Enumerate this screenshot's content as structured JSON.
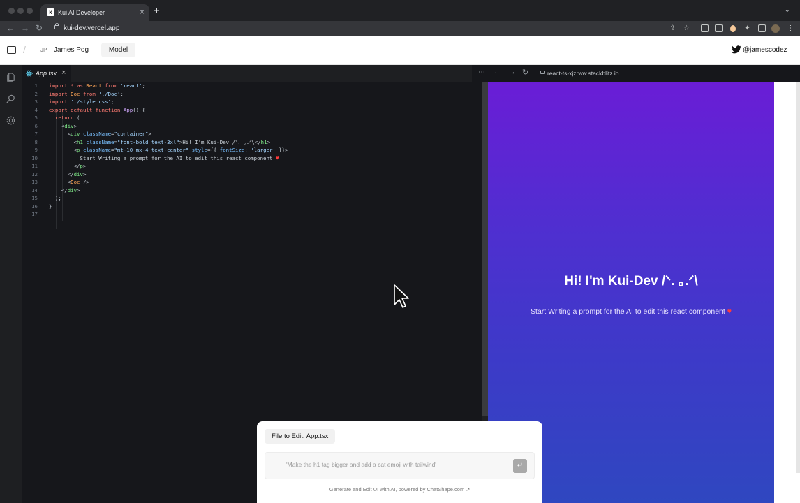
{
  "browser": {
    "tab_title": "Kui AI Developer",
    "tab_favicon": "k",
    "url": "kui-dev.vercel.app"
  },
  "header": {
    "user_initials": "JP",
    "user_name": "James Pog",
    "model_label": "Model",
    "twitter_handle": "@jamescodez"
  },
  "editor": {
    "file_tab": "App.tsx",
    "line_numbers": [
      "1",
      "2",
      "3",
      "4",
      "5",
      "6",
      "7",
      "8",
      "9",
      "10",
      "11",
      "12",
      "13",
      "14",
      "15",
      "16",
      "17"
    ]
  },
  "preview": {
    "url": "react-ts-xjzrww.stackblitz.io",
    "title": "Hi! I'm Kui-Dev /ᐠ. ｡.ᐟ\\",
    "subtitle": "Start Writing a prompt for the AI to edit this react component",
    "heart": "♥"
  },
  "prompt": {
    "file_label": "File to Edit: App.tsx",
    "placeholder": "'Make the h1 tag bigger and add a cat emoji with tailwind'",
    "footer": "Generate and Edit UI with AI, powered by ChatShape.com",
    "footer_arrow": "↗"
  },
  "colors": {
    "preview_gradient_top": "#6a1dd6",
    "preview_gradient_bottom": "#2f47c0",
    "twitter_blue": "#111111"
  }
}
